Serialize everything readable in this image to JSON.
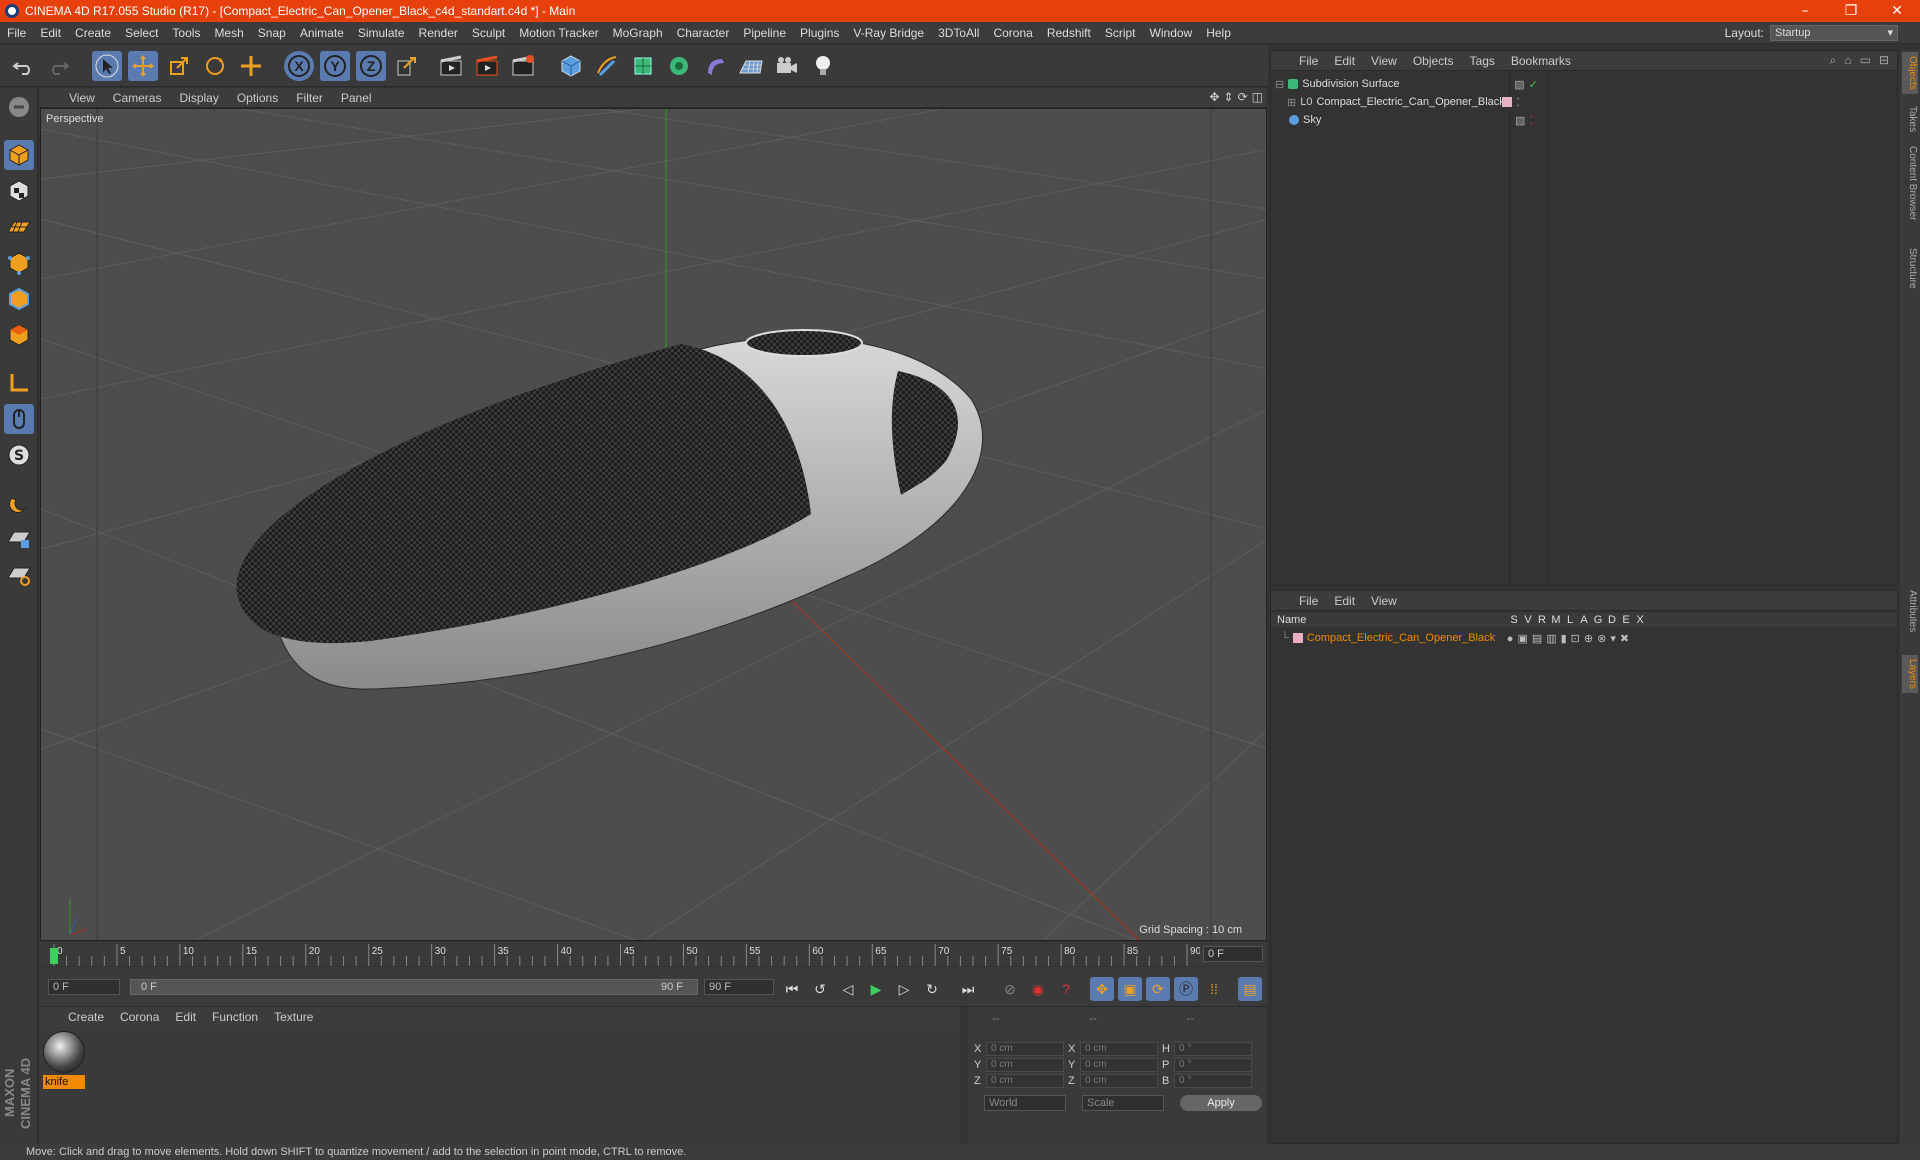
{
  "titlebar": {
    "title": "CINEMA 4D R17.055 Studio (R17) - [Compact_Electric_Can_Opener_Black_c4d_standart.c4d *] - Main",
    "minimize": "–",
    "maximize": "❐",
    "close": "✕"
  },
  "menu": [
    "File",
    "Edit",
    "Create",
    "Select",
    "Tools",
    "Mesh",
    "Snap",
    "Animate",
    "Simulate",
    "Render",
    "Sculpt",
    "Motion Tracker",
    "MoGraph",
    "Character",
    "Pipeline",
    "Plugins",
    "V-Ray Bridge",
    "3DToAll",
    "Corona",
    "Redshift",
    "Script",
    "Window",
    "Help"
  ],
  "layout": {
    "label": "Layout:",
    "value": "Startup"
  },
  "toolbar": {
    "x_label": "X",
    "y_label": "Y",
    "z_label": "Z"
  },
  "viewport": {
    "menu": [
      "View",
      "Cameras",
      "Display",
      "Options",
      "Filter",
      "Panel"
    ],
    "label": "Perspective",
    "grid_spacing": "Grid Spacing : 10 cm"
  },
  "timeline": {
    "ticks": [
      "0",
      "5",
      "10",
      "15",
      "20",
      "25",
      "30",
      "35",
      "40",
      "45",
      "50",
      "55",
      "60",
      "65",
      "70",
      "75",
      "80",
      "85",
      "90"
    ],
    "current_frame": "0 F"
  },
  "transport": {
    "start": "0 F",
    "range_start": "0 F",
    "range_end": "90 F",
    "end": "90 F"
  },
  "material_manager": {
    "menu": [
      "Create",
      "Corona",
      "Edit",
      "Function",
      "Texture"
    ],
    "material_name": "knife"
  },
  "coordinates": {
    "headers": [
      "--",
      "--",
      "--"
    ],
    "rows": [
      {
        "a": "X",
        "v1": "0 cm",
        "b": "X",
        "v2": "0 cm",
        "c": "H",
        "v3": "0 °"
      },
      {
        "a": "Y",
        "v1": "0 cm",
        "b": "Y",
        "v2": "0 cm",
        "c": "P",
        "v3": "0 °"
      },
      {
        "a": "Z",
        "v1": "0 cm",
        "b": "Z",
        "v2": "0 cm",
        "c": "B",
        "v3": "0 °"
      }
    ],
    "mode1": "World",
    "mode2": "Scale",
    "apply": "Apply"
  },
  "objects_panel": {
    "menu": [
      "File",
      "Edit",
      "View",
      "Objects",
      "Tags",
      "Bookmarks"
    ],
    "items": [
      {
        "name": "Subdivision Surface"
      },
      {
        "name": "Compact_Electric_Can_Opener_Black"
      },
      {
        "name": "Sky"
      }
    ]
  },
  "layers_panel": {
    "menu": [
      "File",
      "Edit",
      "View"
    ],
    "columns": [
      "Name",
      "S",
      "V",
      "R",
      "M",
      "L",
      "A",
      "G",
      "D",
      "E",
      "X"
    ],
    "layer_name": "Compact_Electric_Can_Opener_Black"
  },
  "side_tabs": [
    "Objects",
    "Takes",
    "Content Browser",
    "Structure",
    "Attributes",
    "Layers"
  ],
  "brand": "MAXON CINEMA 4D",
  "status": "Move: Click and drag to move elements. Hold down SHIFT to quantize movement / add to the selection in point mode, CTRL to remove.",
  "colors": {
    "title_bar": "#e8400c",
    "active_tool": "#5a7bb0",
    "accent_orange": "#f08a00"
  }
}
